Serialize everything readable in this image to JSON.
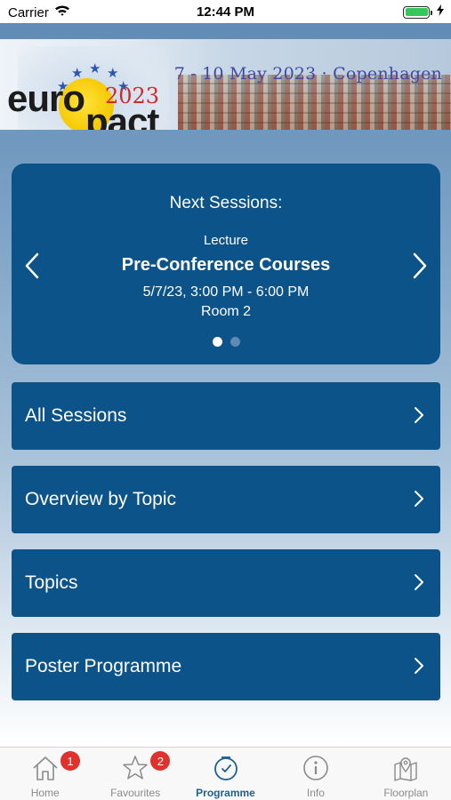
{
  "status_bar": {
    "carrier": "Carrier",
    "time": "12:44 PM"
  },
  "banner": {
    "logo_euro": "euro",
    "logo_pact": "pact",
    "logo_year": "2023",
    "date_location": "7 - 10 May 2023 · Copenhagen"
  },
  "next_sessions": {
    "heading": "Next Sessions:",
    "type": "Lecture",
    "title": "Pre-Conference Courses",
    "time": "5/7/23, 3:00 PM - 6:00 PM",
    "room": "Room 2",
    "page_count": 2,
    "current_page": 1
  },
  "menu": [
    {
      "label": "All Sessions"
    },
    {
      "label": "Overview by Topic"
    },
    {
      "label": "Topics"
    },
    {
      "label": "Poster Programme"
    }
  ],
  "tabs": [
    {
      "label": "Home",
      "icon": "home-icon",
      "badge": "1",
      "active": false
    },
    {
      "label": "Favourites",
      "icon": "star-icon",
      "badge": "2",
      "active": false
    },
    {
      "label": "Programme",
      "icon": "clock-icon",
      "badge": "",
      "active": true
    },
    {
      "label": "Info",
      "icon": "info-icon",
      "badge": "",
      "active": false
    },
    {
      "label": "Floorplan",
      "icon": "map-pin-icon",
      "badge": "",
      "active": false
    }
  ],
  "colors": {
    "accent": "#0b5388",
    "tab_active": "#1d5f94",
    "badge": "#e0322c",
    "battery": "#34c759"
  }
}
